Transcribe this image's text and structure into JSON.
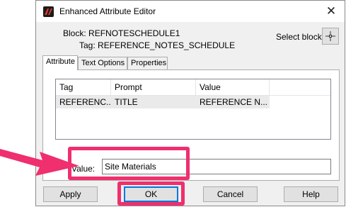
{
  "window": {
    "title": "Enhanced Attribute Editor",
    "close_glyph": "✕"
  },
  "info": {
    "block_label": "Block:",
    "block_value": "REFNOTESCHEDULE1",
    "tag_label": "Tag:",
    "tag_value": "REFERENCE_NOTES_SCHEDULE",
    "select_block_label": "Select block"
  },
  "tabs": [
    {
      "label": "Attribute",
      "active": true
    },
    {
      "label": "Text Options",
      "active": false
    },
    {
      "label": "Properties",
      "active": false
    }
  ],
  "attribute_list": {
    "columns": [
      "Tag",
      "Prompt",
      "Value"
    ],
    "rows": [
      [
        "REFERENC...",
        "TITLE",
        "REFERENCE N..."
      ]
    ]
  },
  "value_field": {
    "label": "Value:",
    "value": "Site Materials"
  },
  "buttons": {
    "apply": "Apply",
    "ok": "OK",
    "cancel": "Cancel",
    "help": "Help"
  },
  "annotation": {
    "highlight_color": "#ef2f6e"
  },
  "icons": {
    "app": "autocad-icon",
    "select_block": "crosshair-icon",
    "close": "close-icon"
  }
}
